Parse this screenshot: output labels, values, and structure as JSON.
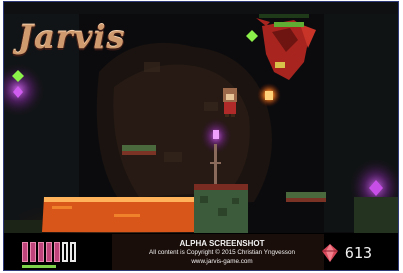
{
  "game": {
    "title": "Jarvis"
  },
  "hud": {
    "health_max": 7,
    "health_current": 5,
    "stamina_level": 0.4,
    "gem_count": "613",
    "caption_line1": "ALPHA SCREENSHOT",
    "caption_line2": "All content is Copyright © 2015 Christian Yngvesson",
    "caption_line3": "www.jarvis-game.com",
    "gem_icon": "red-gem-icon"
  },
  "colors": {
    "health": "#c0447c",
    "stamina": "#7fd34a",
    "lava": "#d9561a",
    "gem": "#d8485a"
  }
}
